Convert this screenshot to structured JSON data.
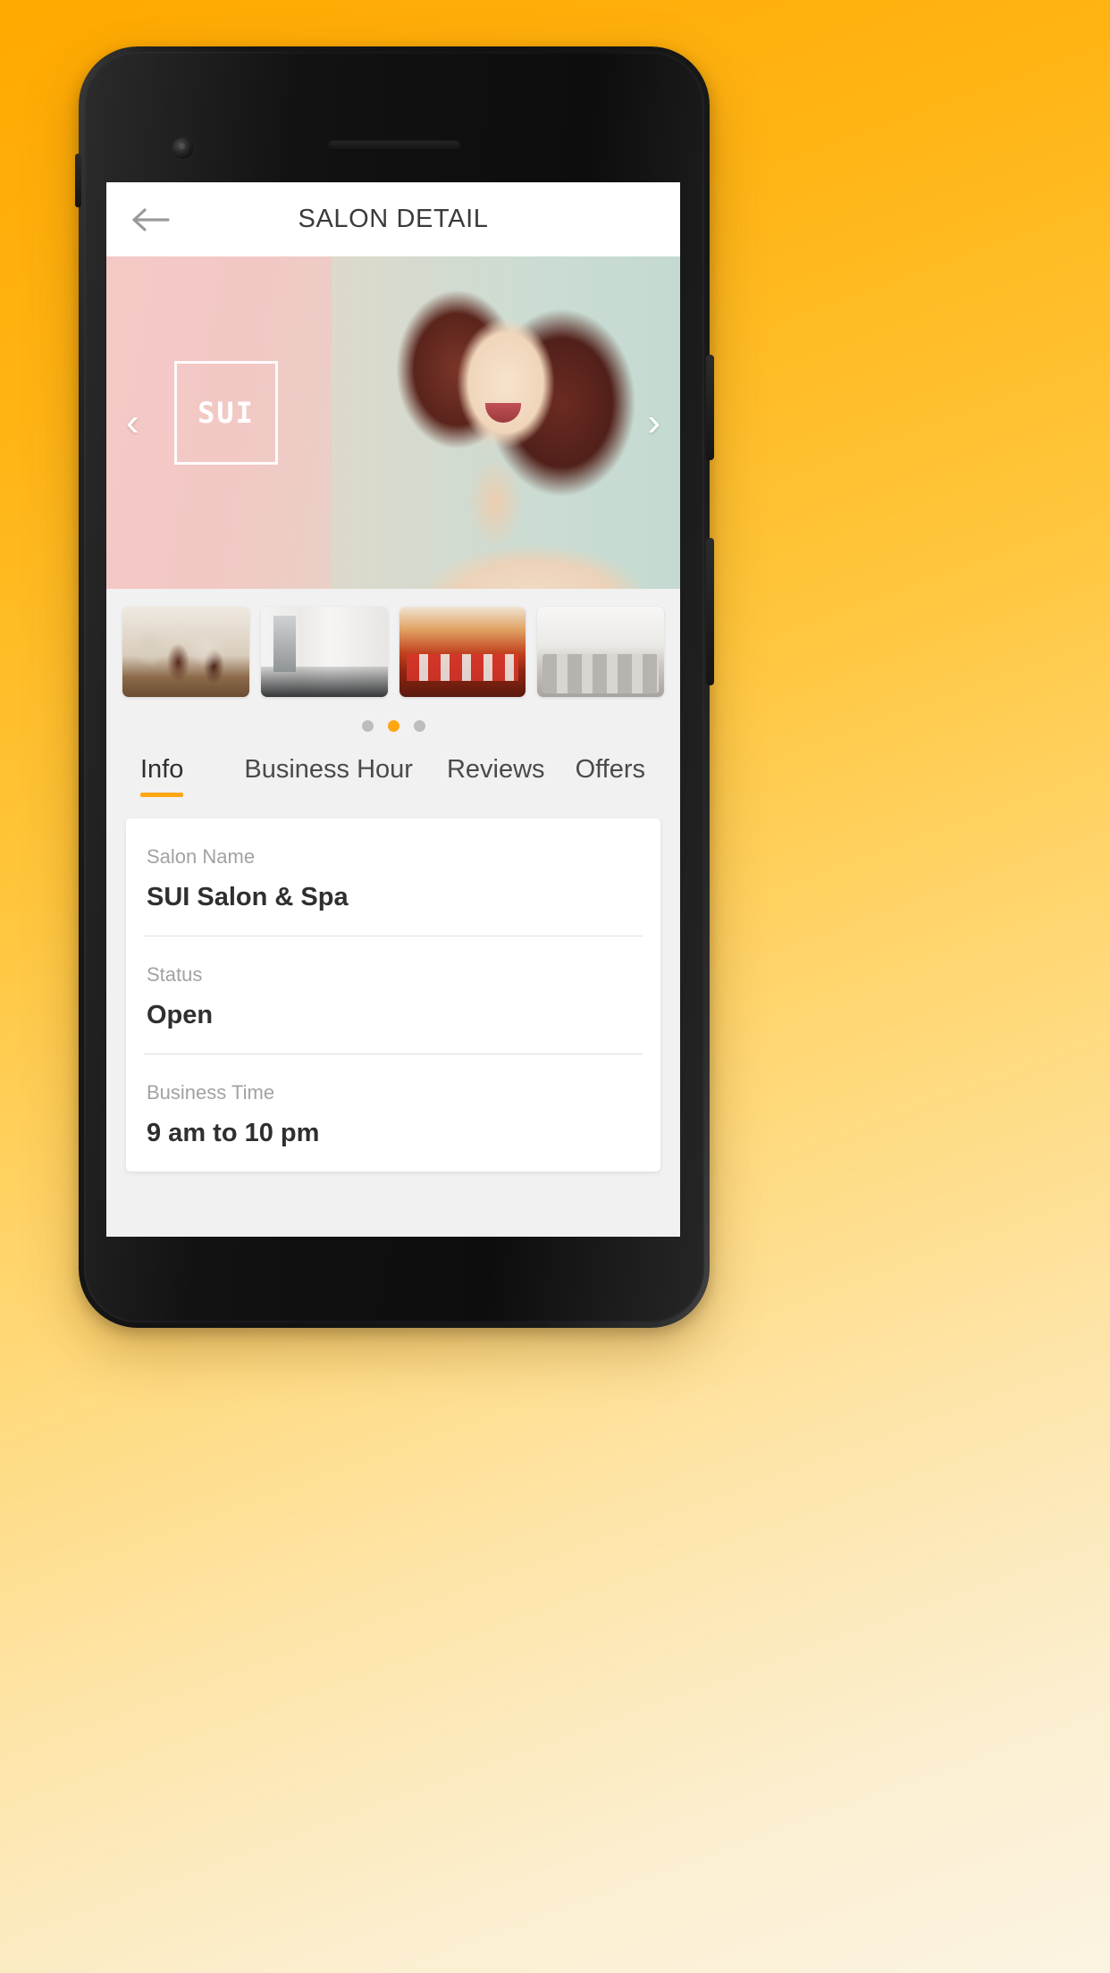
{
  "appbar": {
    "title": "SALON DETAIL",
    "back_icon": "arrow-left-icon"
  },
  "hero": {
    "logo_text": "SUI",
    "prev_icon": "chevron-left-icon",
    "next_icon": "chevron-right-icon"
  },
  "gallery": {
    "thumbnails": [
      {
        "alt": "salon-interior-stylists"
      },
      {
        "alt": "salon-white-mirrors"
      },
      {
        "alt": "salon-orange-red-chairs"
      },
      {
        "alt": "salon-grey-chairs"
      }
    ],
    "dots": [
      {
        "active": false
      },
      {
        "active": true
      },
      {
        "active": false
      }
    ]
  },
  "tabs": [
    {
      "label": "Info",
      "active": true
    },
    {
      "label": "Business Hour",
      "active": false
    },
    {
      "label": "Reviews",
      "active": false
    },
    {
      "label": "Offers",
      "active": false
    }
  ],
  "info_card": {
    "fields": [
      {
        "label": "Salon Name",
        "value": "SUI Salon & Spa"
      },
      {
        "label": "Status",
        "value": "Open"
      },
      {
        "label": "Business Time",
        "value": "9 am to 10 pm"
      }
    ]
  },
  "colors": {
    "accent": "#FFA613",
    "background": "#FFA900",
    "screen_bg": "#f1f1f1",
    "card_bg": "#ffffff",
    "label_text": "#a2a2a2",
    "value_text": "#2f2f2f"
  }
}
